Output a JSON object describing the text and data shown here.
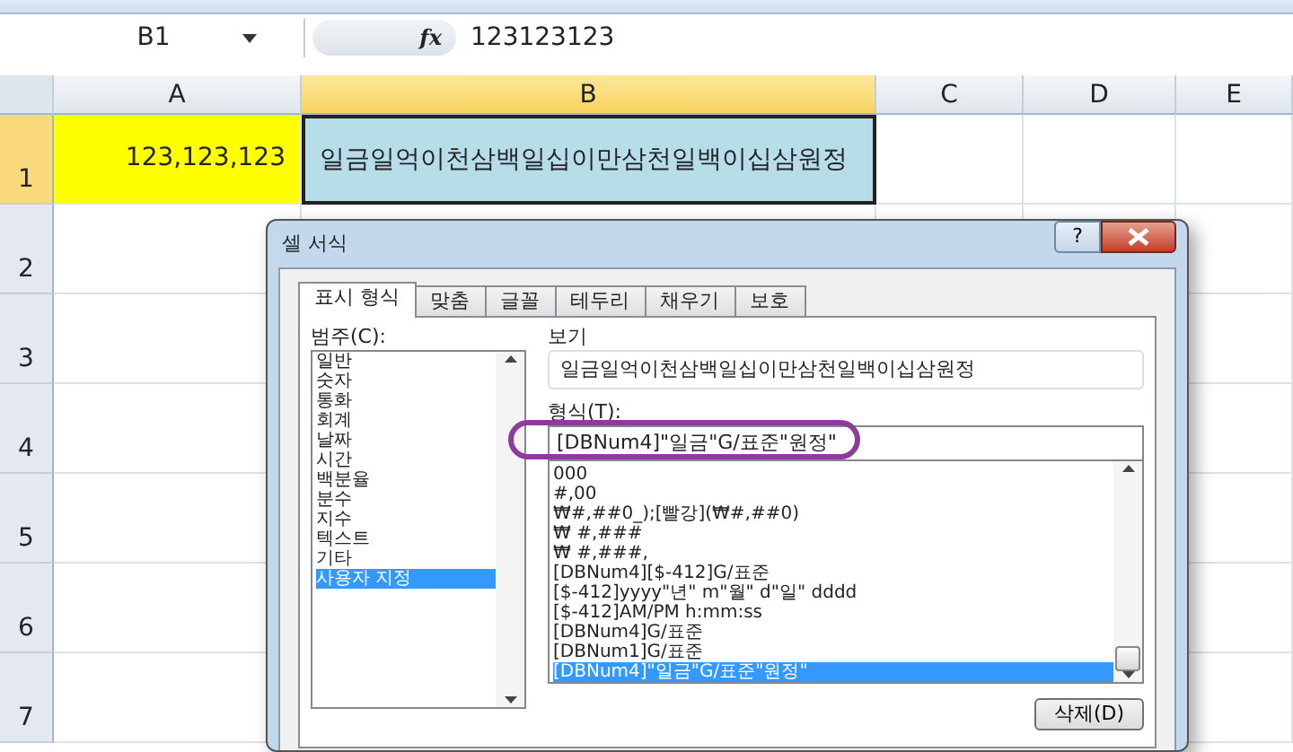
{
  "formula_bar": {
    "name_box": "B1",
    "fx": "fx",
    "value": "123123123"
  },
  "columns": [
    {
      "label": "A",
      "selected": false
    },
    {
      "label": "B",
      "selected": true
    },
    {
      "label": "C",
      "selected": false
    },
    {
      "label": "D",
      "selected": false
    },
    {
      "label": "E",
      "selected": false
    }
  ],
  "rows": [
    {
      "label": "1",
      "selected": true,
      "cells": [
        {
          "text": "123,123,123",
          "color": "#ffff00",
          "kind": "number"
        },
        {
          "text": "일금일억이천삼백일십이만삼천일백이십삼원정",
          "color": "#b7dde8",
          "kind": "text"
        }
      ]
    },
    {
      "label": "2",
      "selected": false,
      "cells": []
    },
    {
      "label": "3",
      "selected": false,
      "cells": []
    },
    {
      "label": "4",
      "selected": false,
      "cells": []
    },
    {
      "label": "5",
      "selected": false,
      "cells": []
    },
    {
      "label": "6",
      "selected": false,
      "cells": []
    },
    {
      "label": "7",
      "selected": false,
      "cells": []
    }
  ],
  "dialog": {
    "title": "셀 서식",
    "help": "?",
    "tabs": [
      {
        "label": "표시 형식",
        "selected": true
      },
      {
        "label": "맞춤",
        "selected": false
      },
      {
        "label": "글꼴",
        "selected": false
      },
      {
        "label": "테두리",
        "selected": false
      },
      {
        "label": "채우기",
        "selected": false
      },
      {
        "label": "보호",
        "selected": false
      }
    ],
    "category_label": "범주(C):",
    "categories": [
      {
        "label": "일반",
        "selected": false
      },
      {
        "label": "숫자",
        "selected": false
      },
      {
        "label": "통화",
        "selected": false
      },
      {
        "label": "회계",
        "selected": false
      },
      {
        "label": "날짜",
        "selected": false
      },
      {
        "label": "시간",
        "selected": false
      },
      {
        "label": "백분율",
        "selected": false
      },
      {
        "label": "분수",
        "selected": false
      },
      {
        "label": "지수",
        "selected": false
      },
      {
        "label": "텍스트",
        "selected": false
      },
      {
        "label": "기타",
        "selected": false
      },
      {
        "label": "사용자 지정",
        "selected": true
      }
    ],
    "sample_label": "보기",
    "sample": "일금일억이천삼백일십이만삼천일백이십삼원정",
    "format_label": "형식(T):",
    "format_value": "[DBNum4]\"일금\"G/표준\"원정\"",
    "formats": [
      {
        "label": "000",
        "selected": false
      },
      {
        "label": "#,00",
        "selected": false
      },
      {
        "label": "₩#,##0_);[빨강](₩#,##0)",
        "selected": false
      },
      {
        "label": "₩ #,###",
        "selected": false
      },
      {
        "label": "₩ #,###,",
        "selected": false
      },
      {
        "label": "[DBNum4][$-412]G/표준",
        "selected": false
      },
      {
        "label": "[$-412]yyyy\"년\" m\"월\" d\"일\" dddd",
        "selected": false
      },
      {
        "label": "[$-412]AM/PM h:mm:ss",
        "selected": false
      },
      {
        "label": "[DBNum4]G/표준",
        "selected": false
      },
      {
        "label": "[DBNum1]G/표준",
        "selected": false
      },
      {
        "label": "[DBNum4]\"일금\"G/표준\"원정\"",
        "selected": true
      }
    ],
    "delete_button": "삭제(D)"
  }
}
